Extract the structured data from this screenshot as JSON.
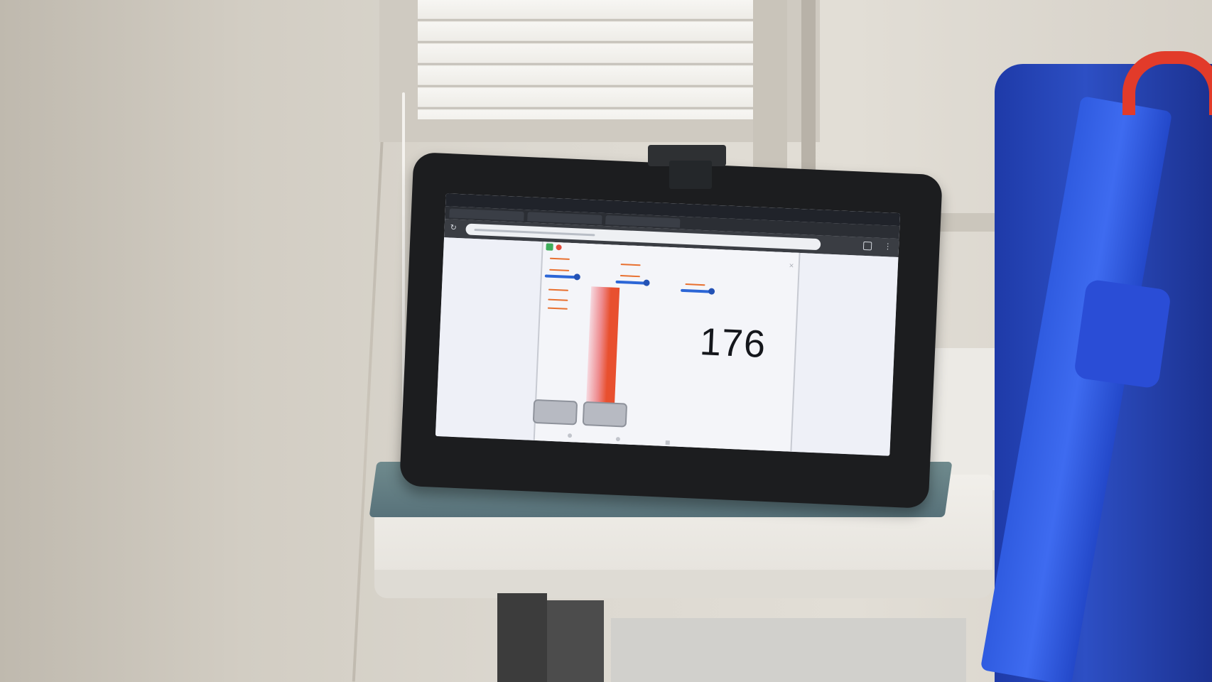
{
  "scene": {
    "description_tags": [
      "wall",
      "window-blinds",
      "table",
      "tablet",
      "blue-bag"
    ]
  },
  "tablet": {
    "status_bar": {
      "time": "",
      "icons": ""
    },
    "browser": {
      "tabs": [
        "",
        "",
        ""
      ],
      "address": ""
    },
    "app": {
      "variables": [
        {
          "label": "",
          "value": ""
        },
        {
          "label": "",
          "value": ""
        },
        {
          "label": "",
          "value": ""
        },
        {
          "label": "",
          "value": ""
        },
        {
          "label": "",
          "value": ""
        },
        {
          "label": "",
          "value": ""
        },
        {
          "label": "",
          "value": ""
        },
        {
          "label": "",
          "value": ""
        }
      ],
      "counter": "176",
      "buttons": [
        "",
        ""
      ]
    }
  },
  "colors": {
    "counter_text": "#15171c",
    "variable_badge": "#e8702f",
    "slider": "#2c66d6",
    "heat_bar": "#e8502f",
    "bag": "#2d4fc4",
    "bag_handle": "#e23b2a"
  }
}
